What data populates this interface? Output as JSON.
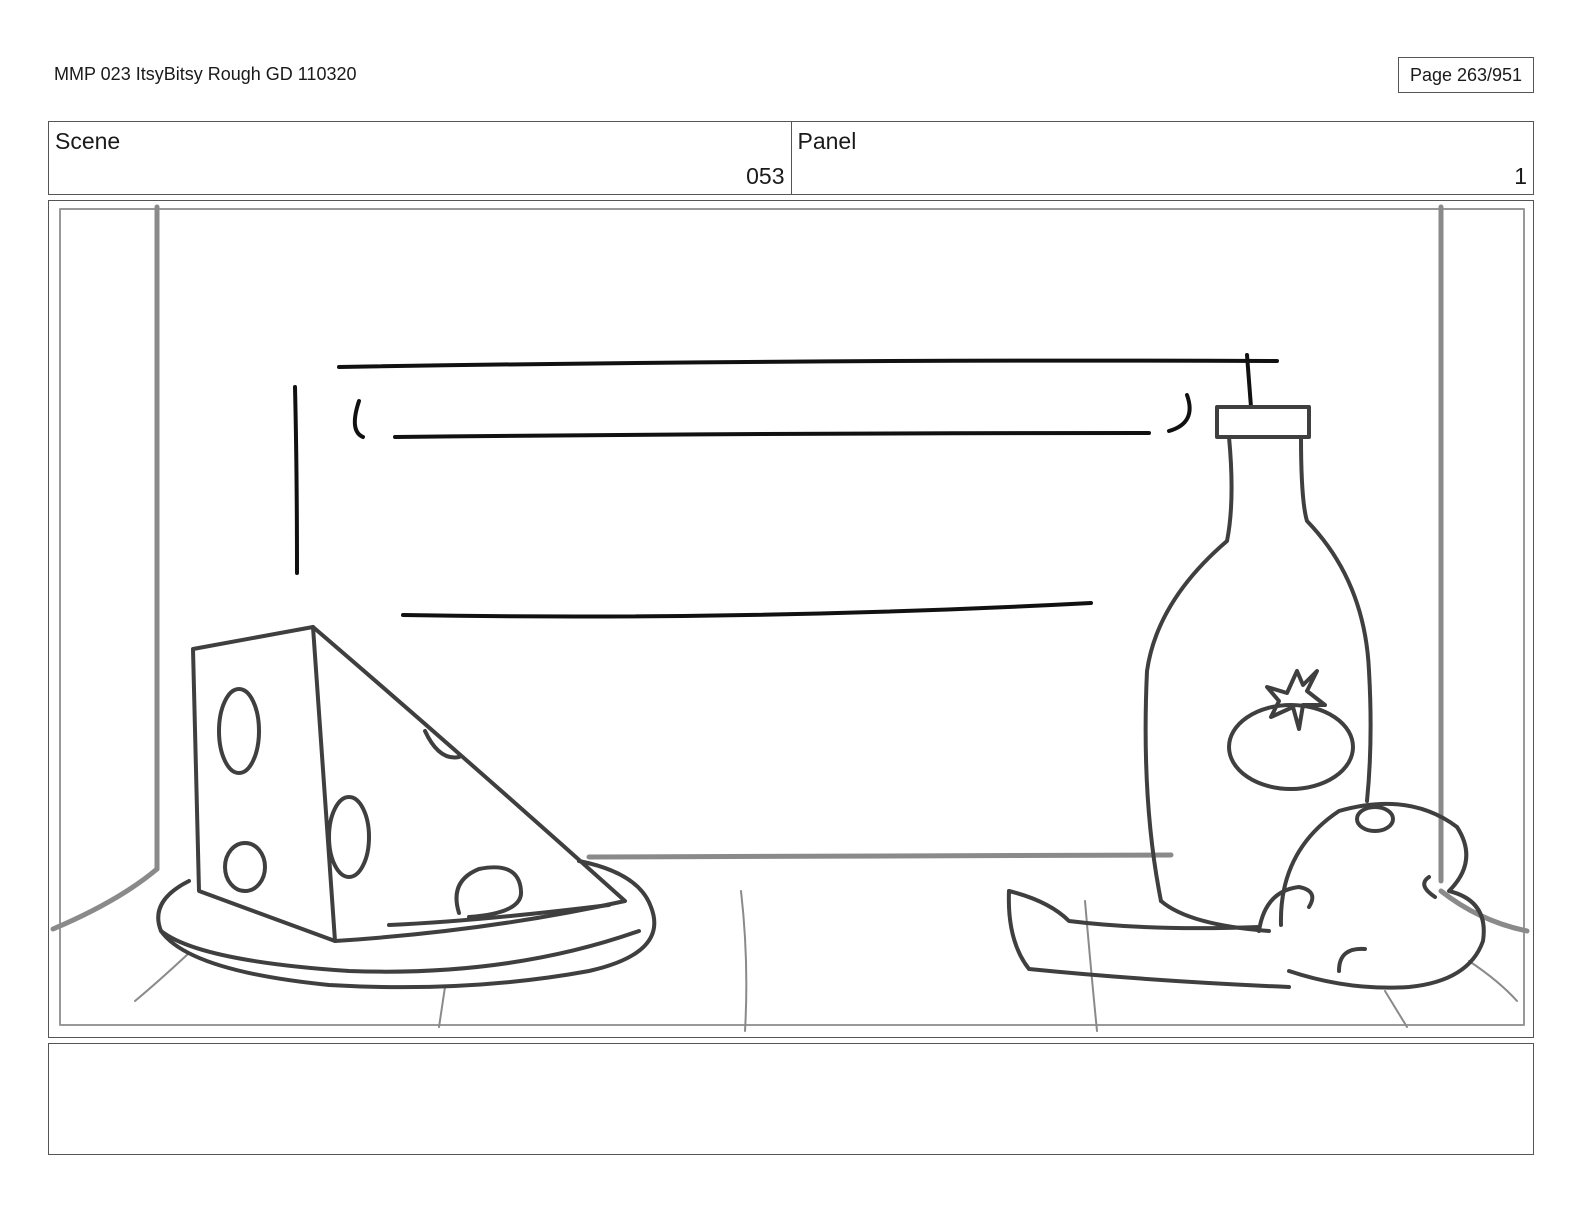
{
  "document": {
    "title": "MMP 023 ItsyBitsy Rough GD 110320",
    "page_label": "Page 263/951"
  },
  "header": {
    "scene_label": "Scene",
    "scene_value": "053",
    "panel_label": "Panel",
    "panel_value": "1"
  },
  "notes": {
    "text": ""
  }
}
